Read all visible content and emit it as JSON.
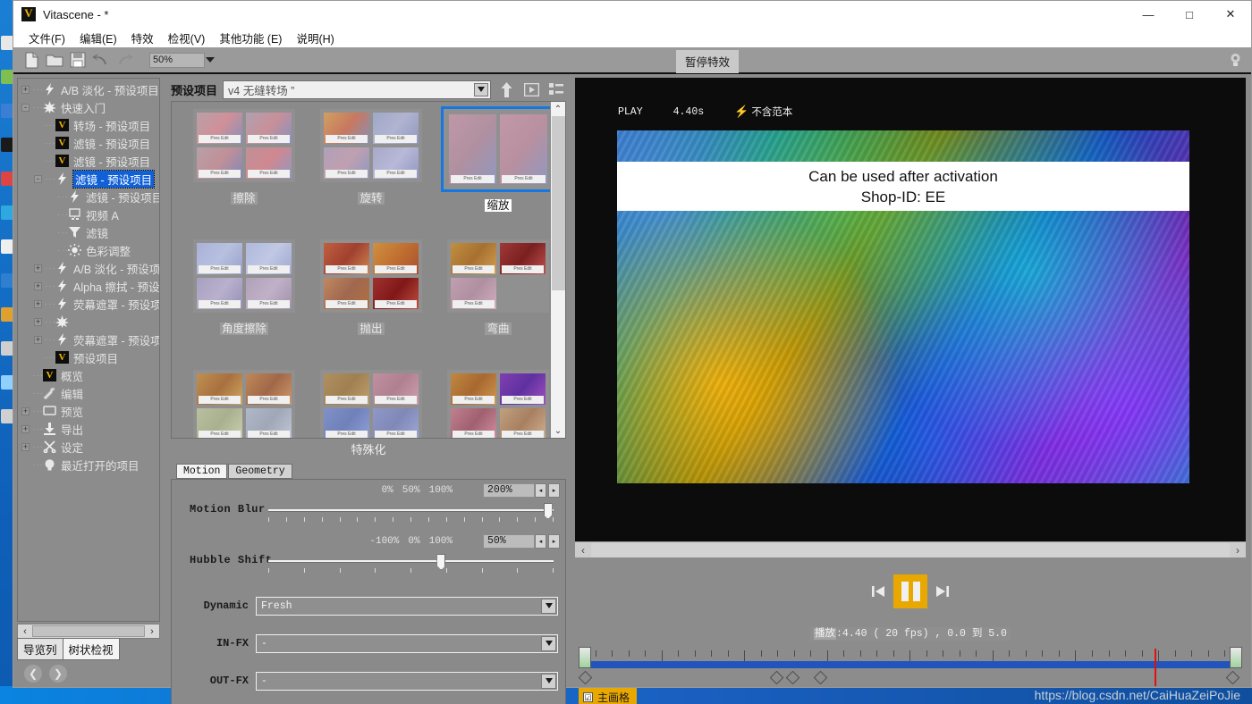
{
  "window": {
    "title": "Vitascene - *",
    "app_icon": "vitascene-v-icon",
    "minimize": "—",
    "maximize": "□",
    "close": "✕"
  },
  "menu": {
    "items": [
      {
        "label": "文件(F)"
      },
      {
        "label": "编辑(E)"
      },
      {
        "label": "特效"
      },
      {
        "label": "检视(V)"
      },
      {
        "label": "其他功能 (E)"
      },
      {
        "label": "说明(H)"
      }
    ]
  },
  "toolbar": {
    "new_icon": "new-document-icon",
    "open_icon": "open-folder-icon",
    "save_icon": "save-disk-icon",
    "undo_icon": "undo-arrow-icon",
    "redo_icon": "redo-arrow-icon",
    "zoom_value": "50%",
    "pause_fx_label": "暂停特效",
    "bulb_icon": "light-bulb-icon"
  },
  "tree": {
    "items": [
      {
        "expander": "+",
        "icon": "bolt-icon",
        "label": "A/B 淡化 - 预设项目",
        "indent": 0,
        "selected": false
      },
      {
        "expander": "-",
        "icon": "burst-icon",
        "label": "快速入门",
        "indent": 0,
        "selected": false
      },
      {
        "expander": "",
        "icon": "v-icon",
        "label": "转场 - 预设项目",
        "indent": 1,
        "selected": false
      },
      {
        "expander": "",
        "icon": "v-icon",
        "label": "滤镜 - 预设项目",
        "indent": 1,
        "selected": false
      },
      {
        "expander": "",
        "icon": "v-icon",
        "label": "滤镜 - 预设项目",
        "indent": 1,
        "selected": false
      },
      {
        "expander": "-",
        "icon": "bolt-icon",
        "label": "滤镜 - 预设项目",
        "indent": 1,
        "selected": true
      },
      {
        "expander": "",
        "icon": "bolt-icon",
        "label": "滤镜 - 预设项目",
        "indent": 2,
        "selected": false
      },
      {
        "expander": "",
        "icon": "monitor-icon",
        "label": "视频 A",
        "indent": 2,
        "selected": false
      },
      {
        "expander": "",
        "icon": "filter-icon",
        "label": "滤镜",
        "indent": 2,
        "selected": false
      },
      {
        "expander": "",
        "icon": "sun-icon",
        "label": "色彩调整",
        "indent": 2,
        "selected": false
      },
      {
        "expander": "+",
        "icon": "bolt-icon",
        "label": "A/B 淡化 - 预设项",
        "indent": 1,
        "selected": false
      },
      {
        "expander": "+",
        "icon": "bolt-icon",
        "label": "Alpha 擦拭 - 预设",
        "indent": 1,
        "selected": false
      },
      {
        "expander": "+",
        "icon": "bolt-icon",
        "label": "荧幕遮罩 - 预设项",
        "indent": 1,
        "selected": false
      },
      {
        "expander": "+",
        "icon": "burst-icon",
        "label": "",
        "indent": 1,
        "selected": false
      },
      {
        "expander": "+",
        "icon": "bolt-icon",
        "label": "荧幕遮罩 - 预设项",
        "indent": 1,
        "selected": false
      },
      {
        "expander": "",
        "icon": "v-icon",
        "label": "预设项目",
        "indent": 1,
        "selected": false
      },
      {
        "expander": "",
        "icon": "v-icon",
        "label": "概览",
        "indent": 0,
        "selected": false
      },
      {
        "expander": "",
        "icon": "wrench-icon",
        "label": "编辑",
        "indent": 0,
        "selected": false
      },
      {
        "expander": "+",
        "icon": "screen-icon",
        "label": "预览",
        "indent": 0,
        "selected": false
      },
      {
        "expander": "+",
        "icon": "download-icon",
        "label": "导出",
        "indent": 0,
        "selected": false
      },
      {
        "expander": "+",
        "icon": "scissors-icon",
        "label": "设定",
        "indent": 0,
        "selected": false
      },
      {
        "expander": "",
        "icon": "bulb-icon",
        "label": "最近打开的项目",
        "indent": 0,
        "selected": false
      }
    ],
    "hscroll_left": "‹",
    "hscroll_right": "›"
  },
  "left_tabs": [
    {
      "label": "导览列",
      "active": false
    },
    {
      "label": "树状检视",
      "active": true
    }
  ],
  "left_nav": {
    "back_icon": "back-arrow-icon",
    "forward_icon": "forward-arrow-icon"
  },
  "presets": {
    "label": "预设项目",
    "selected_set": "v4 无缝转场 ”",
    "dropdown_icon": "chevron-down-icon",
    "up_icon": "up-arrow-icon",
    "play_icon": "play-triangle-icon",
    "list_icon": "list-view-icon",
    "thumb_caption": "Pres Edit",
    "items": [
      {
        "name": "擦除",
        "selected": false,
        "tiles": 4
      },
      {
        "name": "旋转",
        "selected": false,
        "tiles": 4
      },
      {
        "name": "缩放",
        "selected": true,
        "tiles": 2
      },
      {
        "name": "角度擦除",
        "selected": false,
        "tiles": 4
      },
      {
        "name": "抛出",
        "selected": false,
        "tiles": 4
      },
      {
        "name": "弯曲",
        "selected": false,
        "tiles": 3
      },
      {
        "name": "",
        "selected": false,
        "tiles": 4
      },
      {
        "name": "",
        "selected": false,
        "tiles": 4
      },
      {
        "name": "",
        "selected": false,
        "tiles": 4
      }
    ],
    "category_label": "特殊化",
    "scroll_up": "⌃",
    "scroll_down": "⌄"
  },
  "motion": {
    "tabs": [
      {
        "label": "Motion",
        "active": true
      },
      {
        "label": "Geometry",
        "active": false
      }
    ],
    "sliders": [
      {
        "name": "Motion Blur",
        "tick_labels": [
          "0%",
          "50%",
          "100%"
        ],
        "value": "200%",
        "knob_pct": 98
      },
      {
        "name": "Hubble Shift",
        "tick_labels": [
          "-100%",
          "0%",
          "100%"
        ],
        "value": "50%",
        "knob_pct": 60
      }
    ],
    "combos": [
      {
        "name": "Dynamic",
        "value": "Fresh"
      },
      {
        "name": "IN-FX",
        "value": "-"
      },
      {
        "name": "OUT-FX",
        "value": "-"
      }
    ],
    "spin_up": "◂",
    "spin_down": "▸"
  },
  "preview": {
    "hud_state": "PLAY",
    "hud_time": "4.40s",
    "hud_bolt_icon": "bolt-icon",
    "hud_note": "不含范本",
    "banner_line1": "Can be used after activation",
    "banner_line2": "Shop-ID:  EE",
    "hscroll_left": "‹",
    "hscroll_right": "›"
  },
  "transport": {
    "prev_icon": "skip-to-start-icon",
    "pause_icon": "pause-icon",
    "next_icon": "skip-to-end-icon",
    "play_info_label": "播放",
    "play_info_value": ":4.40 ( 20 fps) ,  0.0 到 5.0"
  },
  "timeline": {
    "keyframes_pct": [
      0.3,
      29.5,
      32.0,
      36.2,
      99.3
    ],
    "playhead_pct": 87.0,
    "mainframe_label": "主画格",
    "mainframe_checked": "☑",
    "watermark": "https://blog.csdn.net/CaiHuaZeiPoJie"
  },
  "colors": {
    "accent_blue": "#1478e0",
    "accent_orange": "#e8a800",
    "panel_gray": "#8c8c8c",
    "timeline_blue": "#2255bb",
    "playhead_red": "#e01010"
  }
}
